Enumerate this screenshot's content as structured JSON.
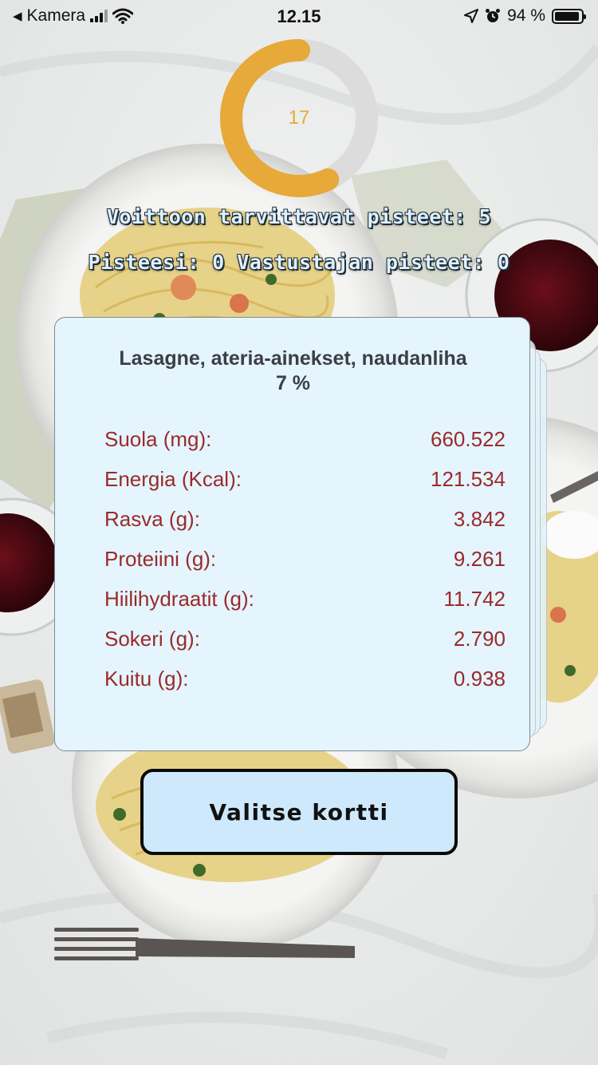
{
  "status_bar": {
    "back_label": "Kamera",
    "time": "12.15",
    "battery_text": "94 %",
    "battery_level": 0.94
  },
  "timer": {
    "value": "17",
    "progress": 0.57,
    "color": "#e6a93a",
    "track_color": "#dcdcdc"
  },
  "game": {
    "points_needed": "Voittoon tarvittavat pisteet: 5",
    "score_line": "Pisteesi: 0 Vastustajan pisteet: 0"
  },
  "card": {
    "title": "Lasagne, ateria-ainekset, naudanliha",
    "percent": "7 %",
    "nutrients": [
      {
        "label": "Suola (mg):",
        "value": "660.522"
      },
      {
        "label": "Energia (Kcal):",
        "value": "121.534"
      },
      {
        "label": "Rasva (g):",
        "value": "3.842"
      },
      {
        "label": "Proteiini (g):",
        "value": "9.261"
      },
      {
        "label": "Hiilihydraatit (g):",
        "value": "11.742"
      },
      {
        "label": "Sokeri (g):",
        "value": "2.790"
      },
      {
        "label": "Kuitu (g):",
        "value": "0.938"
      }
    ]
  },
  "actions": {
    "choose_label": "Valitse kortti"
  },
  "icons": {
    "back": "back-triangle-icon",
    "signal": "signal-bars-icon",
    "wifi": "wifi-icon",
    "location": "location-arrow-icon",
    "alarm": "alarm-clock-icon",
    "battery": "battery-icon"
  }
}
